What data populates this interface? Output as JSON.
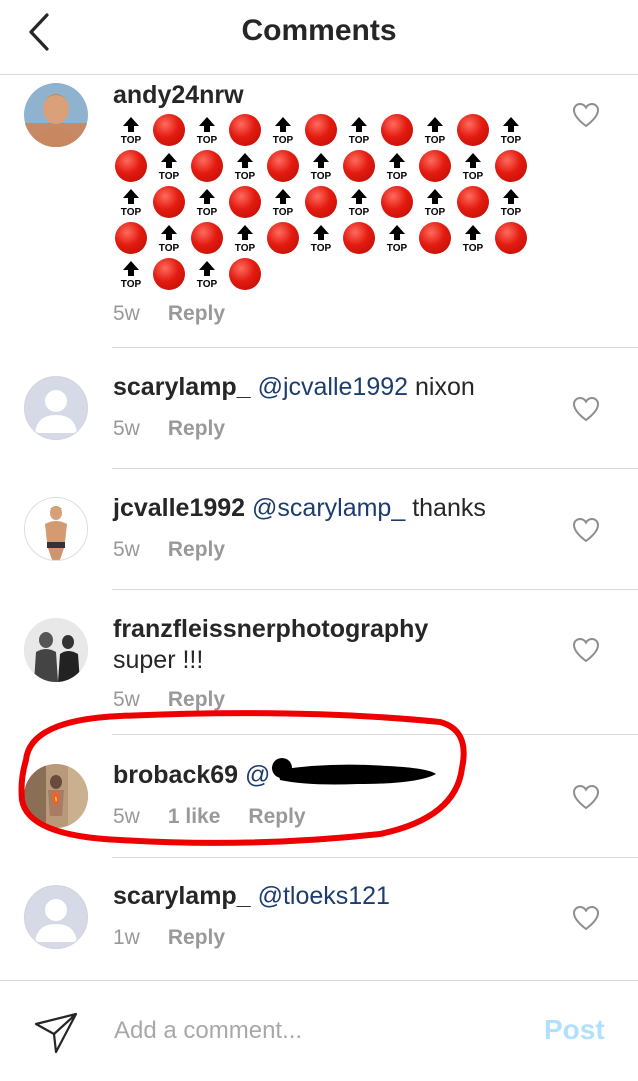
{
  "header": {
    "title": "Comments"
  },
  "comments": [
    {
      "username": "andy24nrw",
      "text": "",
      "time": "5w",
      "likes": "",
      "reply": "Reply",
      "emoji_rows": [
        [
          "top",
          "red",
          "top",
          "red",
          "top",
          "red",
          "top",
          "red",
          "top",
          "red",
          "top"
        ],
        [
          "red",
          "top",
          "red",
          "top",
          "red",
          "top",
          "red",
          "top",
          "red",
          "top",
          "red"
        ],
        [
          "top",
          "red",
          "top",
          "red",
          "top",
          "red",
          "top",
          "red",
          "top",
          "red",
          "top"
        ],
        [
          "red",
          "top",
          "red",
          "top",
          "red",
          "top",
          "red",
          "top",
          "red",
          "top",
          "red"
        ],
        [
          "top",
          "red",
          "top",
          "red"
        ]
      ]
    },
    {
      "username": "scarylamp_",
      "mention": "@jcvalle1992",
      "text": "nixon",
      "time": "5w",
      "likes": "",
      "reply": "Reply"
    },
    {
      "username": "jcvalle1992",
      "mention": "@scarylamp_",
      "text": "thanks",
      "time": "5w",
      "likes": "",
      "reply": "Reply"
    },
    {
      "username": "franzfleissnerphotography",
      "mention": "",
      "text": "super !!!",
      "time": "5w",
      "likes": "",
      "reply": "Reply"
    },
    {
      "username": "broback69",
      "mention": "@",
      "text": "",
      "time": "5w",
      "likes": "1 like",
      "reply": "Reply"
    },
    {
      "username": "scarylamp_",
      "mention": "@tloeks121",
      "text": "",
      "time": "1w",
      "likes": "",
      "reply": "Reply"
    }
  ],
  "emoji_top_label": "TOP",
  "footer": {
    "placeholder": "Add a comment...",
    "post_label": "Post"
  },
  "colors": {
    "mention": "#1c3d6e",
    "post": "#b2dffc",
    "highlight": "#ee0000"
  },
  "icons": [
    "back-arrow-icon",
    "heart-icon",
    "send-icon",
    "top-arrow-emoji",
    "red-circle-emoji"
  ]
}
